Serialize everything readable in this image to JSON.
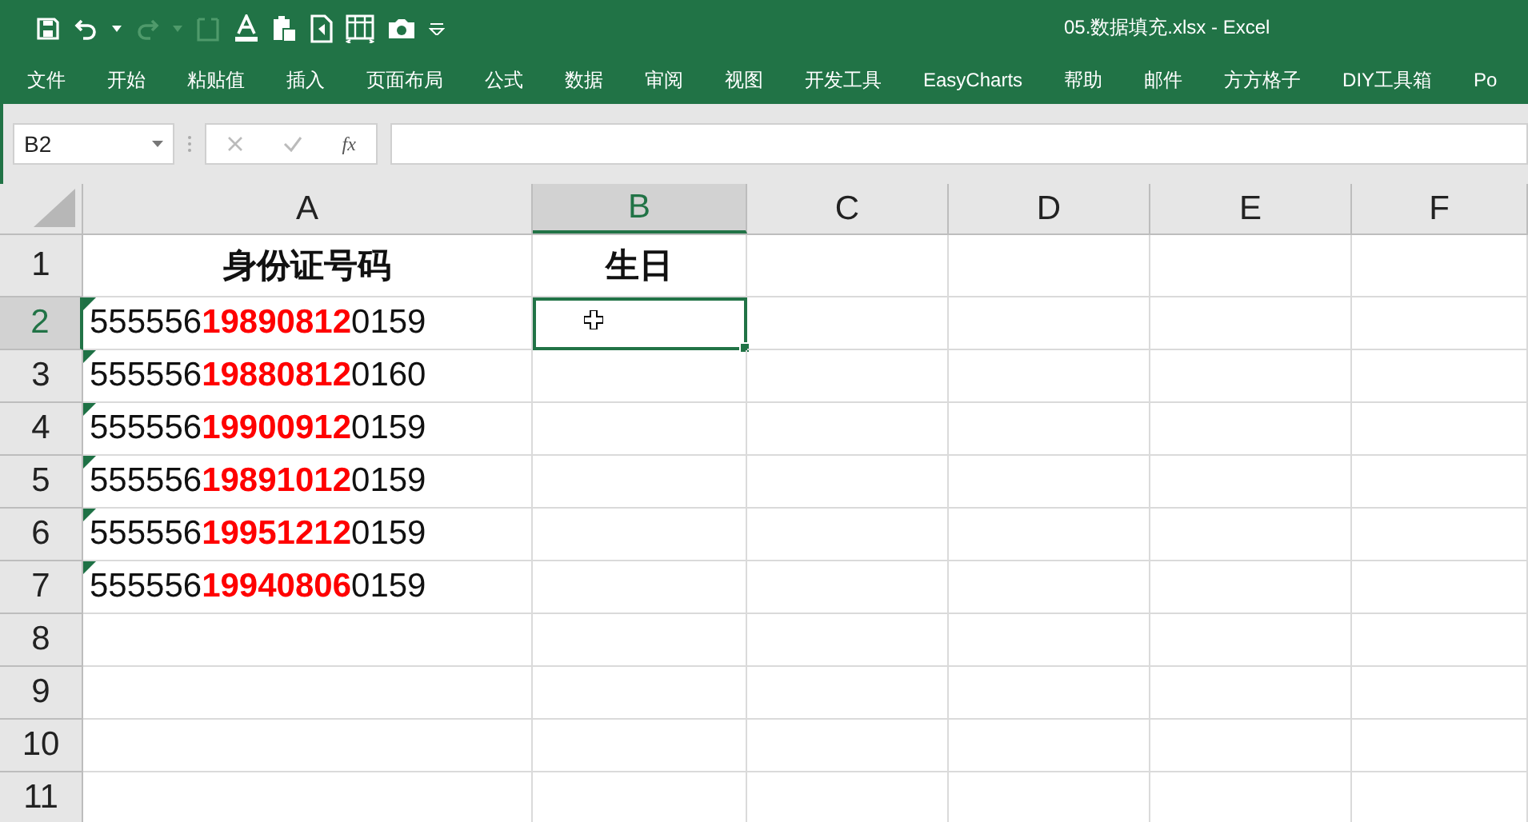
{
  "window": {
    "title": "05.数据填充.xlsx  -  Excel"
  },
  "ribbon_tabs": [
    "文件",
    "开始",
    "粘贴值",
    "插入",
    "页面布局",
    "公式",
    "数据",
    "审阅",
    "视图",
    "开发工具",
    "EasyCharts",
    "帮助",
    "邮件",
    "方方格子",
    "DIY工具箱",
    "Po"
  ],
  "name_box": {
    "value": "B2"
  },
  "formula_bar": {
    "fx": "fx"
  },
  "columns": [
    {
      "label": "A",
      "selected": false
    },
    {
      "label": "B",
      "selected": true
    },
    {
      "label": "C",
      "selected": false
    },
    {
      "label": "D",
      "selected": false
    },
    {
      "label": "E",
      "selected": false
    },
    {
      "label": "F",
      "selected": false
    }
  ],
  "rows": [
    {
      "label": "1",
      "selected": false,
      "kind": "header",
      "cells": [
        "身份证号码",
        "生日"
      ],
      "error_flag": false
    },
    {
      "label": "2",
      "selected": true,
      "kind": "data",
      "cells": [
        "555556**19890812**0159"
      ],
      "error_flag": true
    },
    {
      "label": "3",
      "selected": false,
      "kind": "data",
      "cells": [
        "555556**19880812**0160"
      ],
      "error_flag": true
    },
    {
      "label": "4",
      "selected": false,
      "kind": "data",
      "cells": [
        "555556**19900912**0159"
      ],
      "error_flag": true
    },
    {
      "label": "5",
      "selected": false,
      "kind": "data",
      "cells": [
        "555556**19891012**0159"
      ],
      "error_flag": true
    },
    {
      "label": "6",
      "selected": false,
      "kind": "data",
      "cells": [
        "555556**19951212**0159"
      ],
      "error_flag": true
    },
    {
      "label": "7",
      "selected": false,
      "kind": "data",
      "cells": [
        "555556**19940806**0159"
      ],
      "error_flag": true
    },
    {
      "label": "8",
      "selected": false,
      "kind": "data",
      "error_flag": false
    },
    {
      "label": "9",
      "selected": false,
      "kind": "data",
      "error_flag": false
    },
    {
      "label": "10",
      "selected": false,
      "kind": "data",
      "error_flag": false
    },
    {
      "label": "11",
      "selected": false,
      "kind": "data",
      "error_flag": false
    }
  ]
}
